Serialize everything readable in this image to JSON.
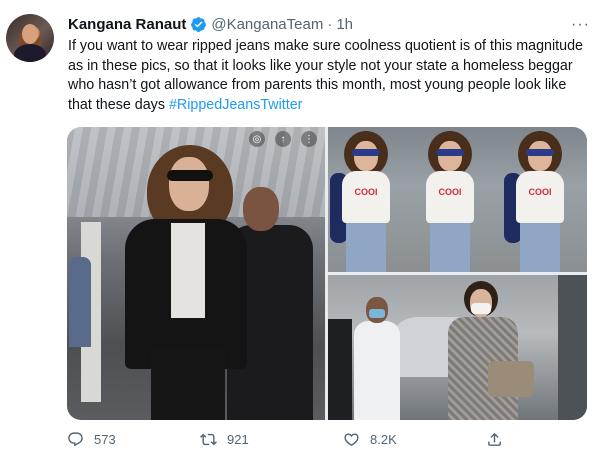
{
  "tweet": {
    "author_name": "Kangana Ranaut",
    "handle": "@KanganaTeam",
    "separator": "·",
    "time": "1h",
    "more_glyph": "···",
    "text_main": "If you want to wear ripped jeans make sure coolness quotient is of this magnitude as in these pics, so that it looks like your style not your state a homeless beggar who hasn’t got allowance from parents this month, most young people look like that these days ",
    "hashtag": "#RippedJeansTwitter",
    "verified_color": "#1d9bf0"
  },
  "media": {
    "photo_count": 3,
    "shirt_text": "COOl"
  },
  "actions": {
    "replies": "573",
    "retweets": "921",
    "likes": "8.2K",
    "icons": [
      "reply-icon",
      "retweet-icon",
      "like-icon",
      "share-icon"
    ]
  }
}
